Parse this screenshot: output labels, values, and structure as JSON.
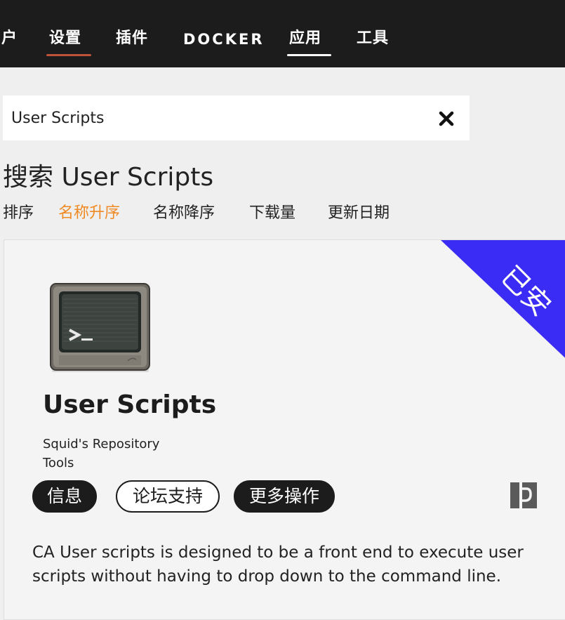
{
  "nav": {
    "items": [
      {
        "label": "户",
        "active": false
      },
      {
        "label": "设置",
        "active": true,
        "underline_color": "#c0513a"
      },
      {
        "label": "插件",
        "active": false
      },
      {
        "label": "DOCKER",
        "active": false
      },
      {
        "label": "应用",
        "active": true,
        "underline_color": "#ffffff"
      },
      {
        "label": "工具",
        "active": false
      }
    ]
  },
  "search": {
    "value": "User Scripts",
    "placeholder": "",
    "clear_icon": "close-icon"
  },
  "page": {
    "title": "搜索 User Scripts"
  },
  "sort": {
    "label": "排序",
    "options": [
      "名称升序",
      "名称降序",
      "下载量",
      "更新日期"
    ],
    "active_index": 0,
    "active_color": "#f08a24"
  },
  "card": {
    "ribbon_text": "已安",
    "ribbon_color": "#3a2cf5",
    "app_icon": "terminal-monitor-icon",
    "name": "User Scripts",
    "repository": "Squid's Repository",
    "category": "Tools",
    "buttons": {
      "info": "信息",
      "forum": "论坛支持",
      "more": "更多操作"
    },
    "side_icon": "beta-icon",
    "description": "CA User scripts is designed to be a front end to execute user scripts without having to drop down to the command line."
  }
}
